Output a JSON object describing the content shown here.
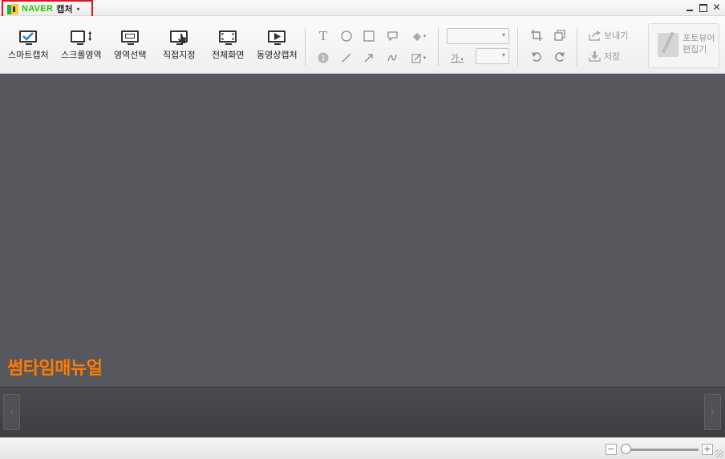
{
  "titlebar": {
    "brand": "NAVER",
    "app_name": "캡처",
    "caret": "▾",
    "close_label": "✕"
  },
  "capture_modes": [
    {
      "label": "스마트캡처",
      "icon": "smart-capture-icon"
    },
    {
      "label": "스크롤영역",
      "icon": "scroll-area-icon"
    },
    {
      "label": "영역선택",
      "icon": "area-select-icon"
    },
    {
      "label": "직접지정",
      "icon": "manual-select-icon"
    },
    {
      "label": "전체화면",
      "icon": "full-screen-icon"
    },
    {
      "label": "동영상캡처",
      "icon": "video-capture-icon"
    }
  ],
  "tools": {
    "text_glyph": "T",
    "font_size_label": "가"
  },
  "actions": {
    "send_label": "보내기",
    "save_label": "저장",
    "editor_label": "포토뷰어 편집기"
  },
  "watermark": "썸타임매뉴얼",
  "strip": {
    "prev_glyph": "‹",
    "next_glyph": "›"
  },
  "zoom": {
    "minus": "−",
    "plus": "+",
    "level": 0.0
  },
  "colors": {
    "brand_green": "#1ec800",
    "highlight_red": "#e0141e",
    "watermark_orange": "#ff7a00",
    "canvas_bg": "#57585d"
  }
}
